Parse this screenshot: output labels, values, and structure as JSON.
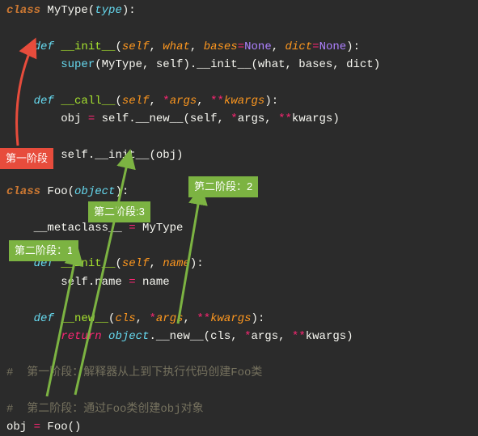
{
  "code": {
    "l1_class": "class",
    "l1_name": " MyType(",
    "l1_type": "type",
    "l1_close": "):",
    "l3_def": "def",
    "l3_fn": " __init__",
    "l3_open": "(",
    "l3_self": "self",
    "l3_c1": ", ",
    "l3_what": "what",
    "l3_c2": ", ",
    "l3_bases": "bases",
    "l3_eq1": "=",
    "l3_none1": "None",
    "l3_c3": ", ",
    "l3_dict": "dict",
    "l3_eq2": "=",
    "l3_none2": "None",
    "l3_close": "):",
    "l4_super": "super",
    "l4_args": "(MyType, self).",
    "l4_init": "__init__",
    "l4_tail": "(what, bases, dict)",
    "l6_def": "def",
    "l6_fn": " __call__",
    "l6_open": "(",
    "l6_self": "self",
    "l6_c1": ", ",
    "l6_star": "*",
    "l6_args": "args",
    "l6_c2": ", ",
    "l6_dstar": "**",
    "l6_kwargs": "kwargs",
    "l6_close": "):",
    "l7_obj": "obj ",
    "l7_eq": "=",
    "l7_self": " self.",
    "l7_new": "__new__",
    "l7_open": "(self, ",
    "l7_star": "*",
    "l7_args": "args, ",
    "l7_dstar": "**",
    "l7_kwargs": "kwargs)",
    "l9_self": "self.",
    "l9_init": "__init__",
    "l9_tail": "(obj)",
    "l11_class": "class",
    "l11_name": " Foo(",
    "l11_obj": "object",
    "l11_close": "):",
    "l13_meta": "__metaclass__ ",
    "l13_eq": "=",
    "l13_val": " MyType",
    "l15_def": "def",
    "l15_fn": " __init__",
    "l15_open": "(",
    "l15_self": "self",
    "l15_c1": ", ",
    "l15_name": "name",
    "l15_close": "):",
    "l16_selfname": "self.name ",
    "l16_eq": "=",
    "l16_tail": " name",
    "l18_def": "def",
    "l18_fn": " __new__",
    "l18_open": "(",
    "l18_cls": "cls",
    "l18_c1": ", ",
    "l18_star": "*",
    "l18_args": "args",
    "l18_c2": ", ",
    "l18_dstar": "**",
    "l18_kwargs": "kwargs",
    "l18_close": "):",
    "l19_ret": "return",
    "l19_obj": " object",
    "l19_dot": ".",
    "l19_new": "__new__",
    "l19_open": "(cls, ",
    "l19_star": "*",
    "l19_args": "args, ",
    "l19_dstar": "**",
    "l19_kwargs": "kwargs)",
    "c1": "#  第一阶段：解释器从上到下执行代码创建Foo类",
    "c2": "#  第二阶段：通过Foo类创建obj对象",
    "l22_obj": "obj ",
    "l22_eq": "=",
    "l22_call": " Foo()"
  },
  "labels": {
    "stage1": "第一阶段",
    "stage2_1": "第二阶段：1",
    "stage2_2": "第二阶段：2",
    "stage2_3": "第二阶段:3"
  }
}
